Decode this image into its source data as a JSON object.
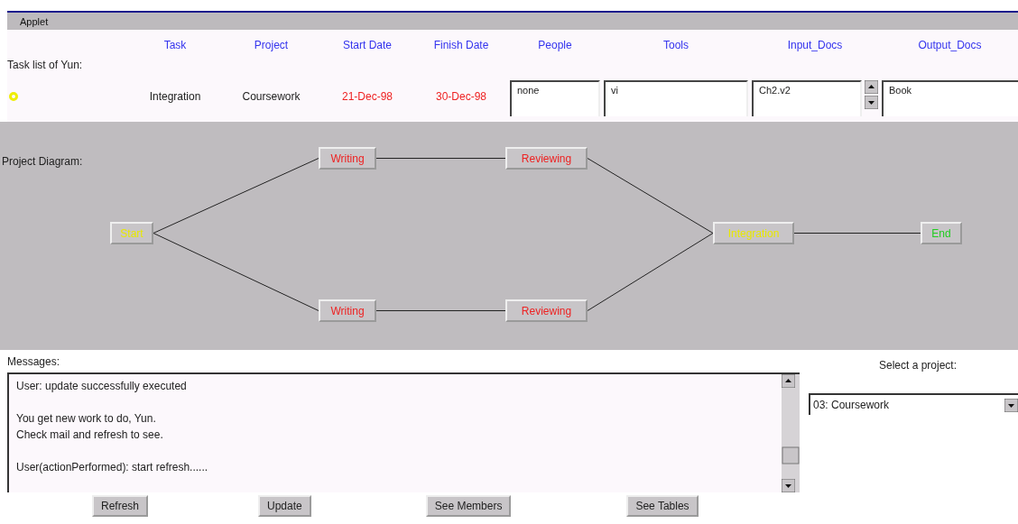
{
  "window": {
    "title": "Applet"
  },
  "task_table": {
    "label": "Task list of Yun:",
    "columns": [
      "Task",
      "Project",
      "Start Date",
      "Finish Date",
      "People",
      "Tools",
      "Input_Docs",
      "Output_Docs"
    ],
    "rows": [
      {
        "color": "#eeee00",
        "task": "Integration",
        "project": "Coursework",
        "start_date": "21-Dec-98",
        "finish_date": "30-Dec-98",
        "people": "none",
        "tools": "vi",
        "input_docs": "Ch2.v2",
        "output_docs": "Book"
      }
    ]
  },
  "diagram": {
    "label": "Project Diagram:",
    "nodes": [
      {
        "label": "Start",
        "color": "#e8e800"
      },
      {
        "label": "Writing",
        "color": "#ee2222"
      },
      {
        "label": "Reviewing",
        "color": "#ee2222"
      },
      {
        "label": "Writing",
        "color": "#ee2222"
      },
      {
        "label": "Reviewing",
        "color": "#ee2222"
      },
      {
        "label": "Integration",
        "color": "#e8e800"
      },
      {
        "label": "End",
        "color": "#22cc22"
      }
    ]
  },
  "messages": {
    "label": "Messages:",
    "paragraphs": [
      "User: update successfully executed",
      "You get new work to do, Yun.\nCheck mail and refresh to see.",
      "User(actionPerformed): start refresh......"
    ]
  },
  "project_select": {
    "label": "Select a project:",
    "value": "03: Coursework"
  },
  "buttons": [
    "Refresh",
    "Update",
    "See Members",
    "See Tables"
  ]
}
